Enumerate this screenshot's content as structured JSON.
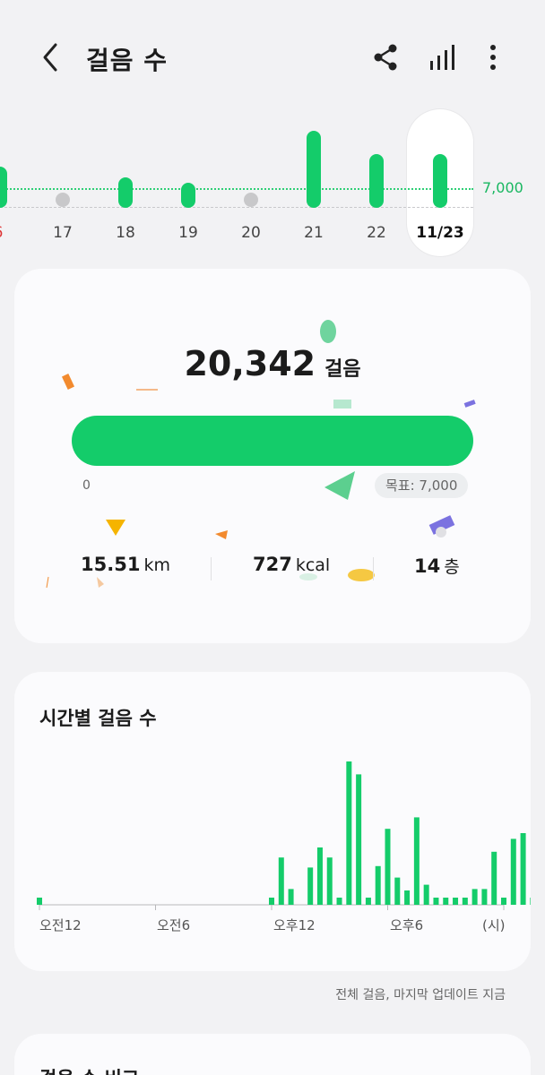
{
  "header": {
    "title": "걸음 수",
    "icons": [
      "back-icon",
      "share-icon",
      "bar-chart-icon",
      "more-vert-icon"
    ]
  },
  "week": {
    "goal_label": "7,000",
    "days": [
      {
        "label": "6",
        "steps_level": "bar-short",
        "weekend": true
      },
      {
        "label": "17",
        "steps_level": "none"
      },
      {
        "label": "18",
        "steps_level": "bar-short"
      },
      {
        "label": "19",
        "steps_level": "bar-short"
      },
      {
        "label": "20",
        "steps_level": "none"
      },
      {
        "label": "21",
        "steps_level": "bar-tall"
      },
      {
        "label": "22",
        "steps_level": "bar-mid"
      },
      {
        "label": "11/23",
        "steps_level": "bar-mid",
        "selected": true
      }
    ]
  },
  "summary": {
    "steps": "20,342",
    "steps_unit": "걸음",
    "progress_start": "0",
    "goal_text": "목표: 7,000",
    "progress_fraction": 1.0,
    "distance_value": "15.51",
    "distance_unit": "km",
    "calories_value": "727",
    "calories_unit": "kcal",
    "floors_value": "14",
    "floors_unit": "층"
  },
  "hourly": {
    "title": "시간별 걸음 수",
    "axis_labels": [
      "오전12",
      "오전6",
      "오후12",
      "오후6",
      "(시)"
    ],
    "footnote": "전체 걸음, 마지막 업데이트 지금"
  },
  "chart_data": {
    "type": "bar",
    "title": "시간별 걸음 수",
    "xlabel": "(시)",
    "ylabel": "",
    "x": [
      0,
      1,
      2,
      3,
      4,
      5,
      6,
      7,
      8,
      9,
      10,
      11,
      12,
      13,
      14,
      15,
      16,
      17,
      18,
      19,
      20,
      21,
      22,
      23
    ],
    "series": [
      {
        "values": [
          [
            40
          ],
          [
            0
          ],
          [
            0
          ],
          [
            0
          ],
          [
            0
          ],
          [
            0
          ],
          [
            0
          ],
          [
            0
          ],
          [
            0
          ],
          [
            0
          ],
          [
            0
          ],
          [
            0
          ],
          [
            0
          ],
          [
            0
          ],
          [
            0
          ],
          [
            0
          ],
          [
            0
          ],
          [
            0
          ],
          [
            0
          ],
          [
            0
          ],
          [
            0
          ],
          [
            0
          ],
          [
            0
          ],
          [
            0
          ]
        ]
      }
    ],
    "half_hour_bars": [
      0.05,
      0,
      0,
      0,
      0,
      0,
      0,
      0,
      0,
      0,
      0,
      0,
      0,
      0,
      0,
      0,
      0,
      0,
      0,
      0,
      0,
      0,
      0,
      0,
      0.05,
      0.33,
      0.11,
      0,
      0.26,
      0.4,
      0.33,
      0.05,
      1.0,
      0.91,
      0.05,
      0.27,
      0.53,
      0.19,
      0.1,
      0.61,
      0.14,
      0.05,
      0.05,
      0.05,
      0.05,
      0.11,
      0.11,
      0.37,
      0.05,
      0.46,
      0.5,
      0.05,
      0.05,
      0.44
    ],
    "ylim": [
      0,
      1
    ]
  },
  "compare": {
    "title": "걸음 수 비교"
  }
}
